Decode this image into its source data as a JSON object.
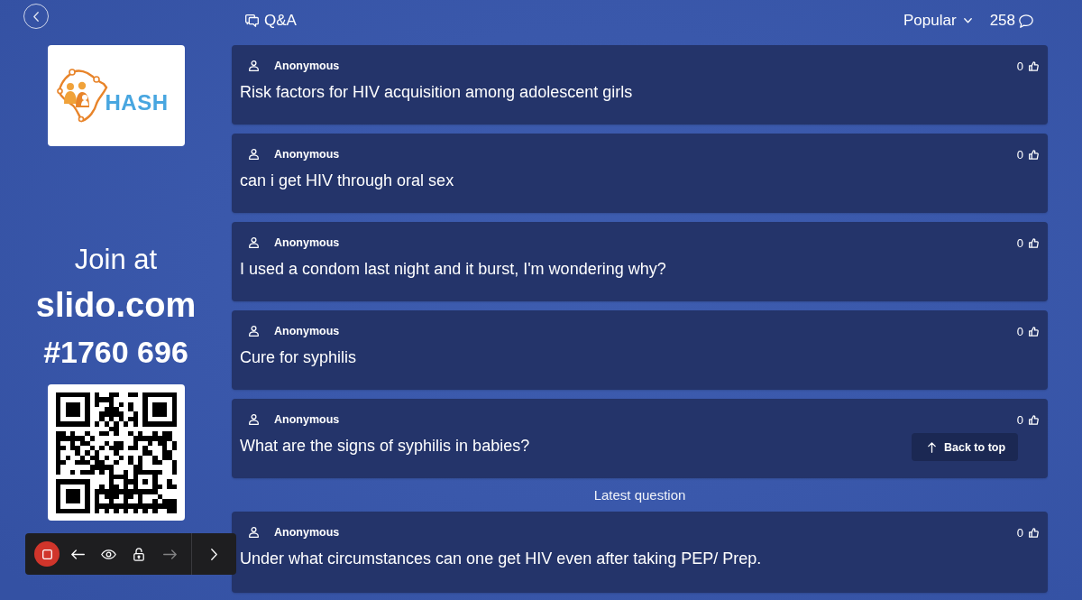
{
  "header": {
    "title": "Q&A",
    "sort": "Popular",
    "count": "258"
  },
  "sidebar": {
    "logo_text": "HASH",
    "join_prefix": "Join at",
    "join_site": "slido.com",
    "event_code": "#1760 696"
  },
  "questions": [
    {
      "author": "Anonymous",
      "text": "Risk factors for HIV acquisition among adolescent girls",
      "votes": "0"
    },
    {
      "author": "Anonymous",
      "text": "can i get HIV through oral sex",
      "votes": "0"
    },
    {
      "author": "Anonymous",
      "text": "I used a condom last night and it burst, I'm wondering why?",
      "votes": "0"
    },
    {
      "author": "Anonymous",
      "text": "Cure for syphilis",
      "votes": "0"
    },
    {
      "author": "Anonymous",
      "text": "What are the signs of syphilis in babies?",
      "votes": "0"
    }
  ],
  "back_to_top": "Back to top",
  "latest_label": "Latest question",
  "latest_question": {
    "author": "Anonymous",
    "text": "Under what circumstances can one get HIV even after taking PEP/ Prep.",
    "votes": "0"
  },
  "presenter_toolbar": {
    "buttons": [
      {
        "kind": "stop",
        "disabled": false
      },
      {
        "kind": "previous",
        "disabled": false
      },
      {
        "kind": "view",
        "disabled": false
      },
      {
        "kind": "lock",
        "disabled": false
      },
      {
        "kind": "next",
        "disabled": true
      },
      {
        "kind": "expand",
        "disabled": false
      }
    ]
  }
}
